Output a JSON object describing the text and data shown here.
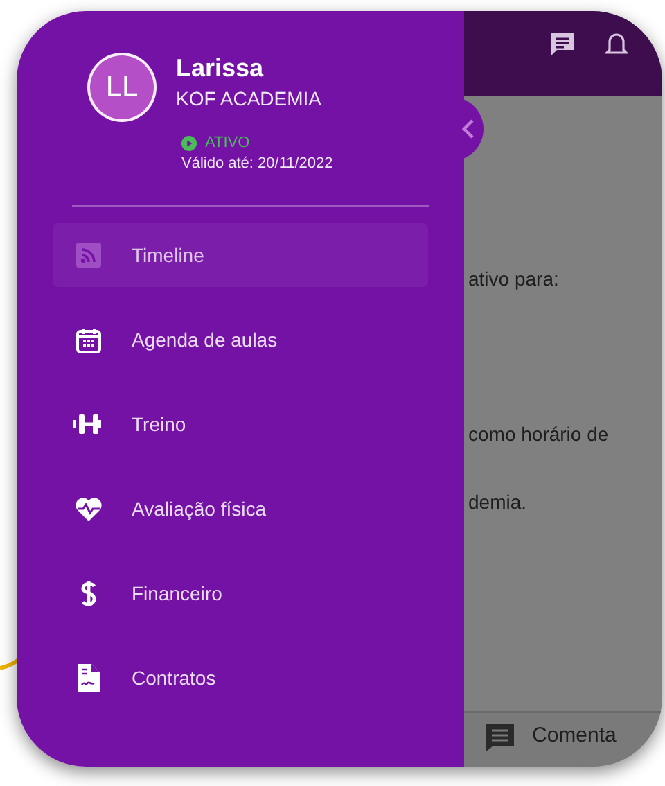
{
  "profile": {
    "initials": "LL",
    "name": "Larissa",
    "company": "KOF ACADEMIA",
    "status": {
      "label": "ATIVO",
      "active": true
    },
    "valid_until": "Válido até: 20/11/2022"
  },
  "menu": [
    {
      "label": "Timeline",
      "selected": true
    },
    {
      "label": "Agenda de aulas",
      "selected": false
    },
    {
      "label": "Treino",
      "selected": false
    },
    {
      "label": "Avaliação física",
      "selected": false
    },
    {
      "label": "Financeiro",
      "selected": false
    },
    {
      "label": "Contratos",
      "selected": false
    }
  ],
  "background_content": {
    "lines": [
      "ativo para:",
      "como horário de",
      "demia."
    ],
    "bottom_bar": {
      "label": "Comenta"
    }
  }
}
